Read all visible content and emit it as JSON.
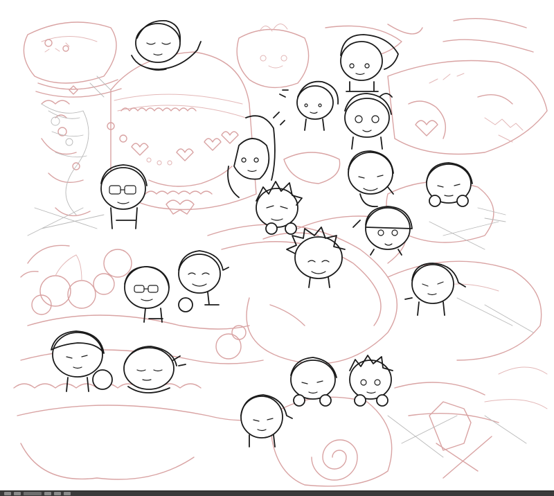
{
  "canvas": {
    "background": "#ffffff",
    "colors": {
      "underdrawing": "#d9a3a3",
      "guide_lines": "#b8b8b8",
      "ink": "#1a1a1a"
    }
  },
  "taskbar": {
    "items": [
      "app-icon",
      "app-icon",
      "app-icon",
      "tool-icon",
      "tool-icon",
      "tool-icon"
    ]
  }
}
